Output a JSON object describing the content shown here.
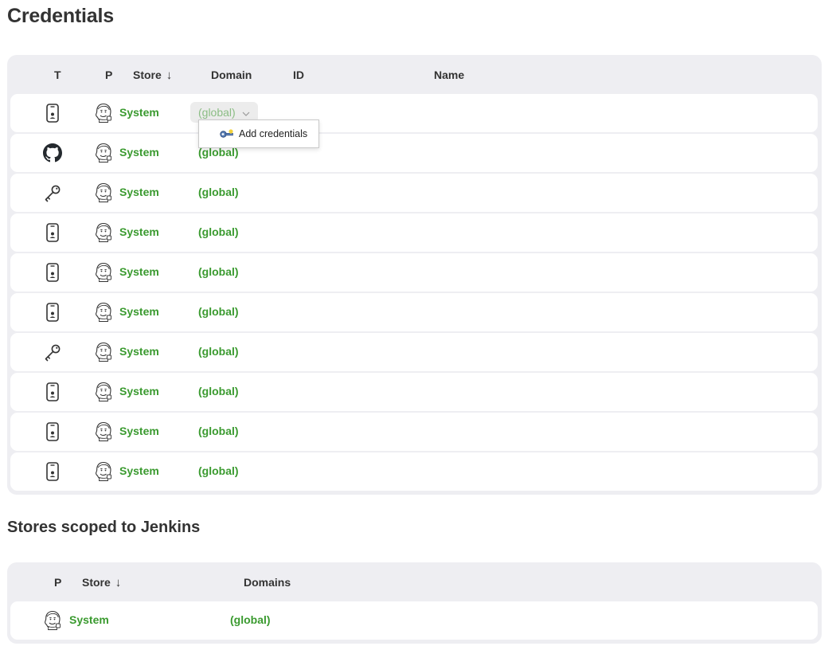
{
  "page_title": "Credentials",
  "credentials_table": {
    "headers": {
      "type": "T",
      "provider": "P",
      "store": "Store",
      "store_sort": "↓",
      "domain": "Domain",
      "id": "ID",
      "name": "Name"
    },
    "rows": [
      {
        "type_icon": "certificate-icon",
        "store": "System",
        "domain": "(global)"
      },
      {
        "type_icon": "github-icon",
        "store": "System",
        "domain": "(global)"
      },
      {
        "type_icon": "key-icon",
        "store": "System",
        "domain": "(global)"
      },
      {
        "type_icon": "certificate-icon",
        "store": "System",
        "domain": "(global)"
      },
      {
        "type_icon": "certificate-icon",
        "store": "System",
        "domain": "(global)"
      },
      {
        "type_icon": "certificate-icon",
        "store": "System",
        "domain": "(global)"
      },
      {
        "type_icon": "key-icon",
        "store": "System",
        "domain": "(global)"
      },
      {
        "type_icon": "certificate-icon",
        "store": "System",
        "domain": "(global)"
      },
      {
        "type_icon": "certificate-icon",
        "store": "System",
        "domain": "(global)"
      },
      {
        "type_icon": "certificate-icon",
        "store": "System",
        "domain": "(global)"
      }
    ]
  },
  "domain_menu": {
    "item_label": "Add credentials"
  },
  "stores_section": {
    "title": "Stores scoped to Jenkins",
    "headers": {
      "provider": "P",
      "store": "Store",
      "store_sort": "↓",
      "domains": "Domains"
    },
    "rows": [
      {
        "store": "System",
        "domains": "(global)"
      }
    ]
  },
  "colors": {
    "link": "#3a9a2f",
    "card_bg": "#eeeef2"
  }
}
